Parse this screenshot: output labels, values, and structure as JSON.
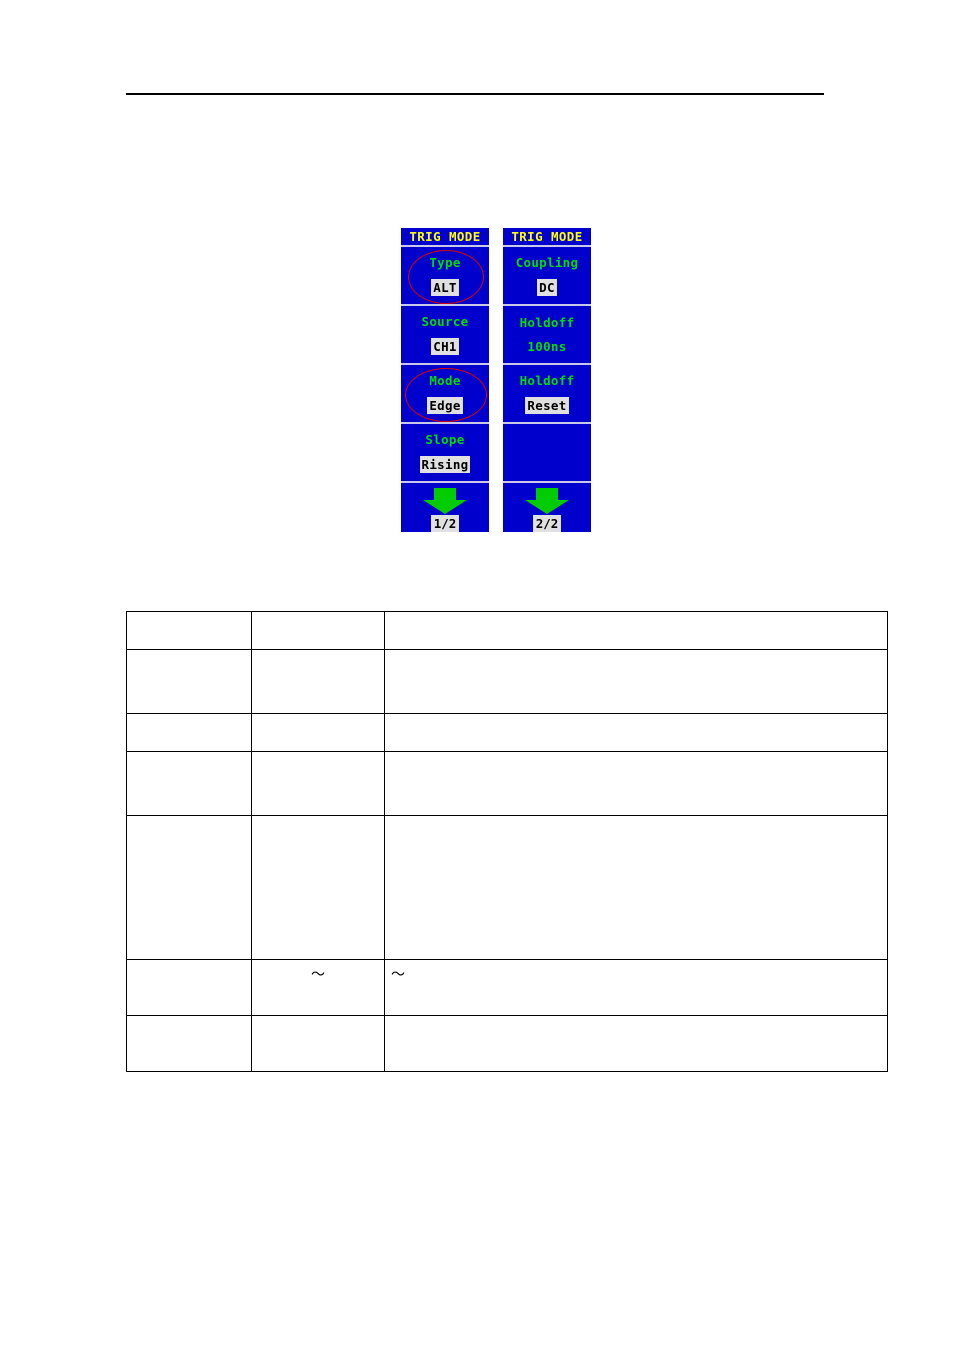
{
  "page": {
    "background_color": "#ffffff",
    "header_rule": true
  },
  "menu_panels": [
    {
      "panel_id": "trig-mode-page-1",
      "title": "TRIG MODE",
      "title_color": "#ffff00",
      "background_color": "#0000cc",
      "label_color": "#00dd00",
      "items": [
        {
          "label": "Type",
          "value": "ALT",
          "value_style": "highlight",
          "annotated": true
        },
        {
          "label": "Source",
          "value": "CH1",
          "value_style": "highlight",
          "annotated": false
        },
        {
          "label": "Mode",
          "value": "Edge",
          "value_style": "highlight",
          "annotated": true
        },
        {
          "label": "Slope",
          "value": "Rising",
          "value_style": "highlight",
          "annotated": false
        }
      ],
      "pager": {
        "icon": "down-arrow-icon",
        "arrow_color": "#00cc00",
        "page_label": "1/2"
      }
    },
    {
      "panel_id": "trig-mode-page-2",
      "title": "TRIG MODE",
      "title_color": "#ffff00",
      "background_color": "#0000cc",
      "label_color": "#00dd00",
      "items": [
        {
          "label": "Coupling",
          "value": "DC",
          "value_style": "highlight",
          "annotated": false
        },
        {
          "label": "Holdoff",
          "value": "100ns",
          "value_style": "plain",
          "annotated": false
        },
        {
          "label": "Holdoff",
          "value": "Reset",
          "value_style": "highlight",
          "annotated": false
        },
        {
          "label": "",
          "value": "",
          "value_style": "blank",
          "annotated": false
        }
      ],
      "pager": {
        "icon": "down-arrow-icon",
        "arrow_color": "#00cc00",
        "page_label": "2/2"
      }
    }
  ],
  "annotations": {
    "color": "#dd0000",
    "shapes": [
      {
        "target": "type-alt-item",
        "shape": "ellipse"
      },
      {
        "target": "mode-edge-item",
        "shape": "ellipse"
      }
    ]
  },
  "spec_table": {
    "columns": [
      "",
      "",
      ""
    ],
    "rows": [
      {
        "cells": [
          "",
          "",
          ""
        ]
      },
      {
        "cells": [
          "",
          "",
          ""
        ]
      },
      {
        "cells": [
          "",
          "",
          ""
        ]
      },
      {
        "cells": [
          "",
          "",
          ""
        ]
      },
      {
        "cells": [
          "",
          "",
          ""
        ]
      },
      {
        "cells": [
          "",
          "～",
          "～"
        ]
      },
      {
        "cells": [
          "",
          "",
          ""
        ]
      }
    ]
  }
}
